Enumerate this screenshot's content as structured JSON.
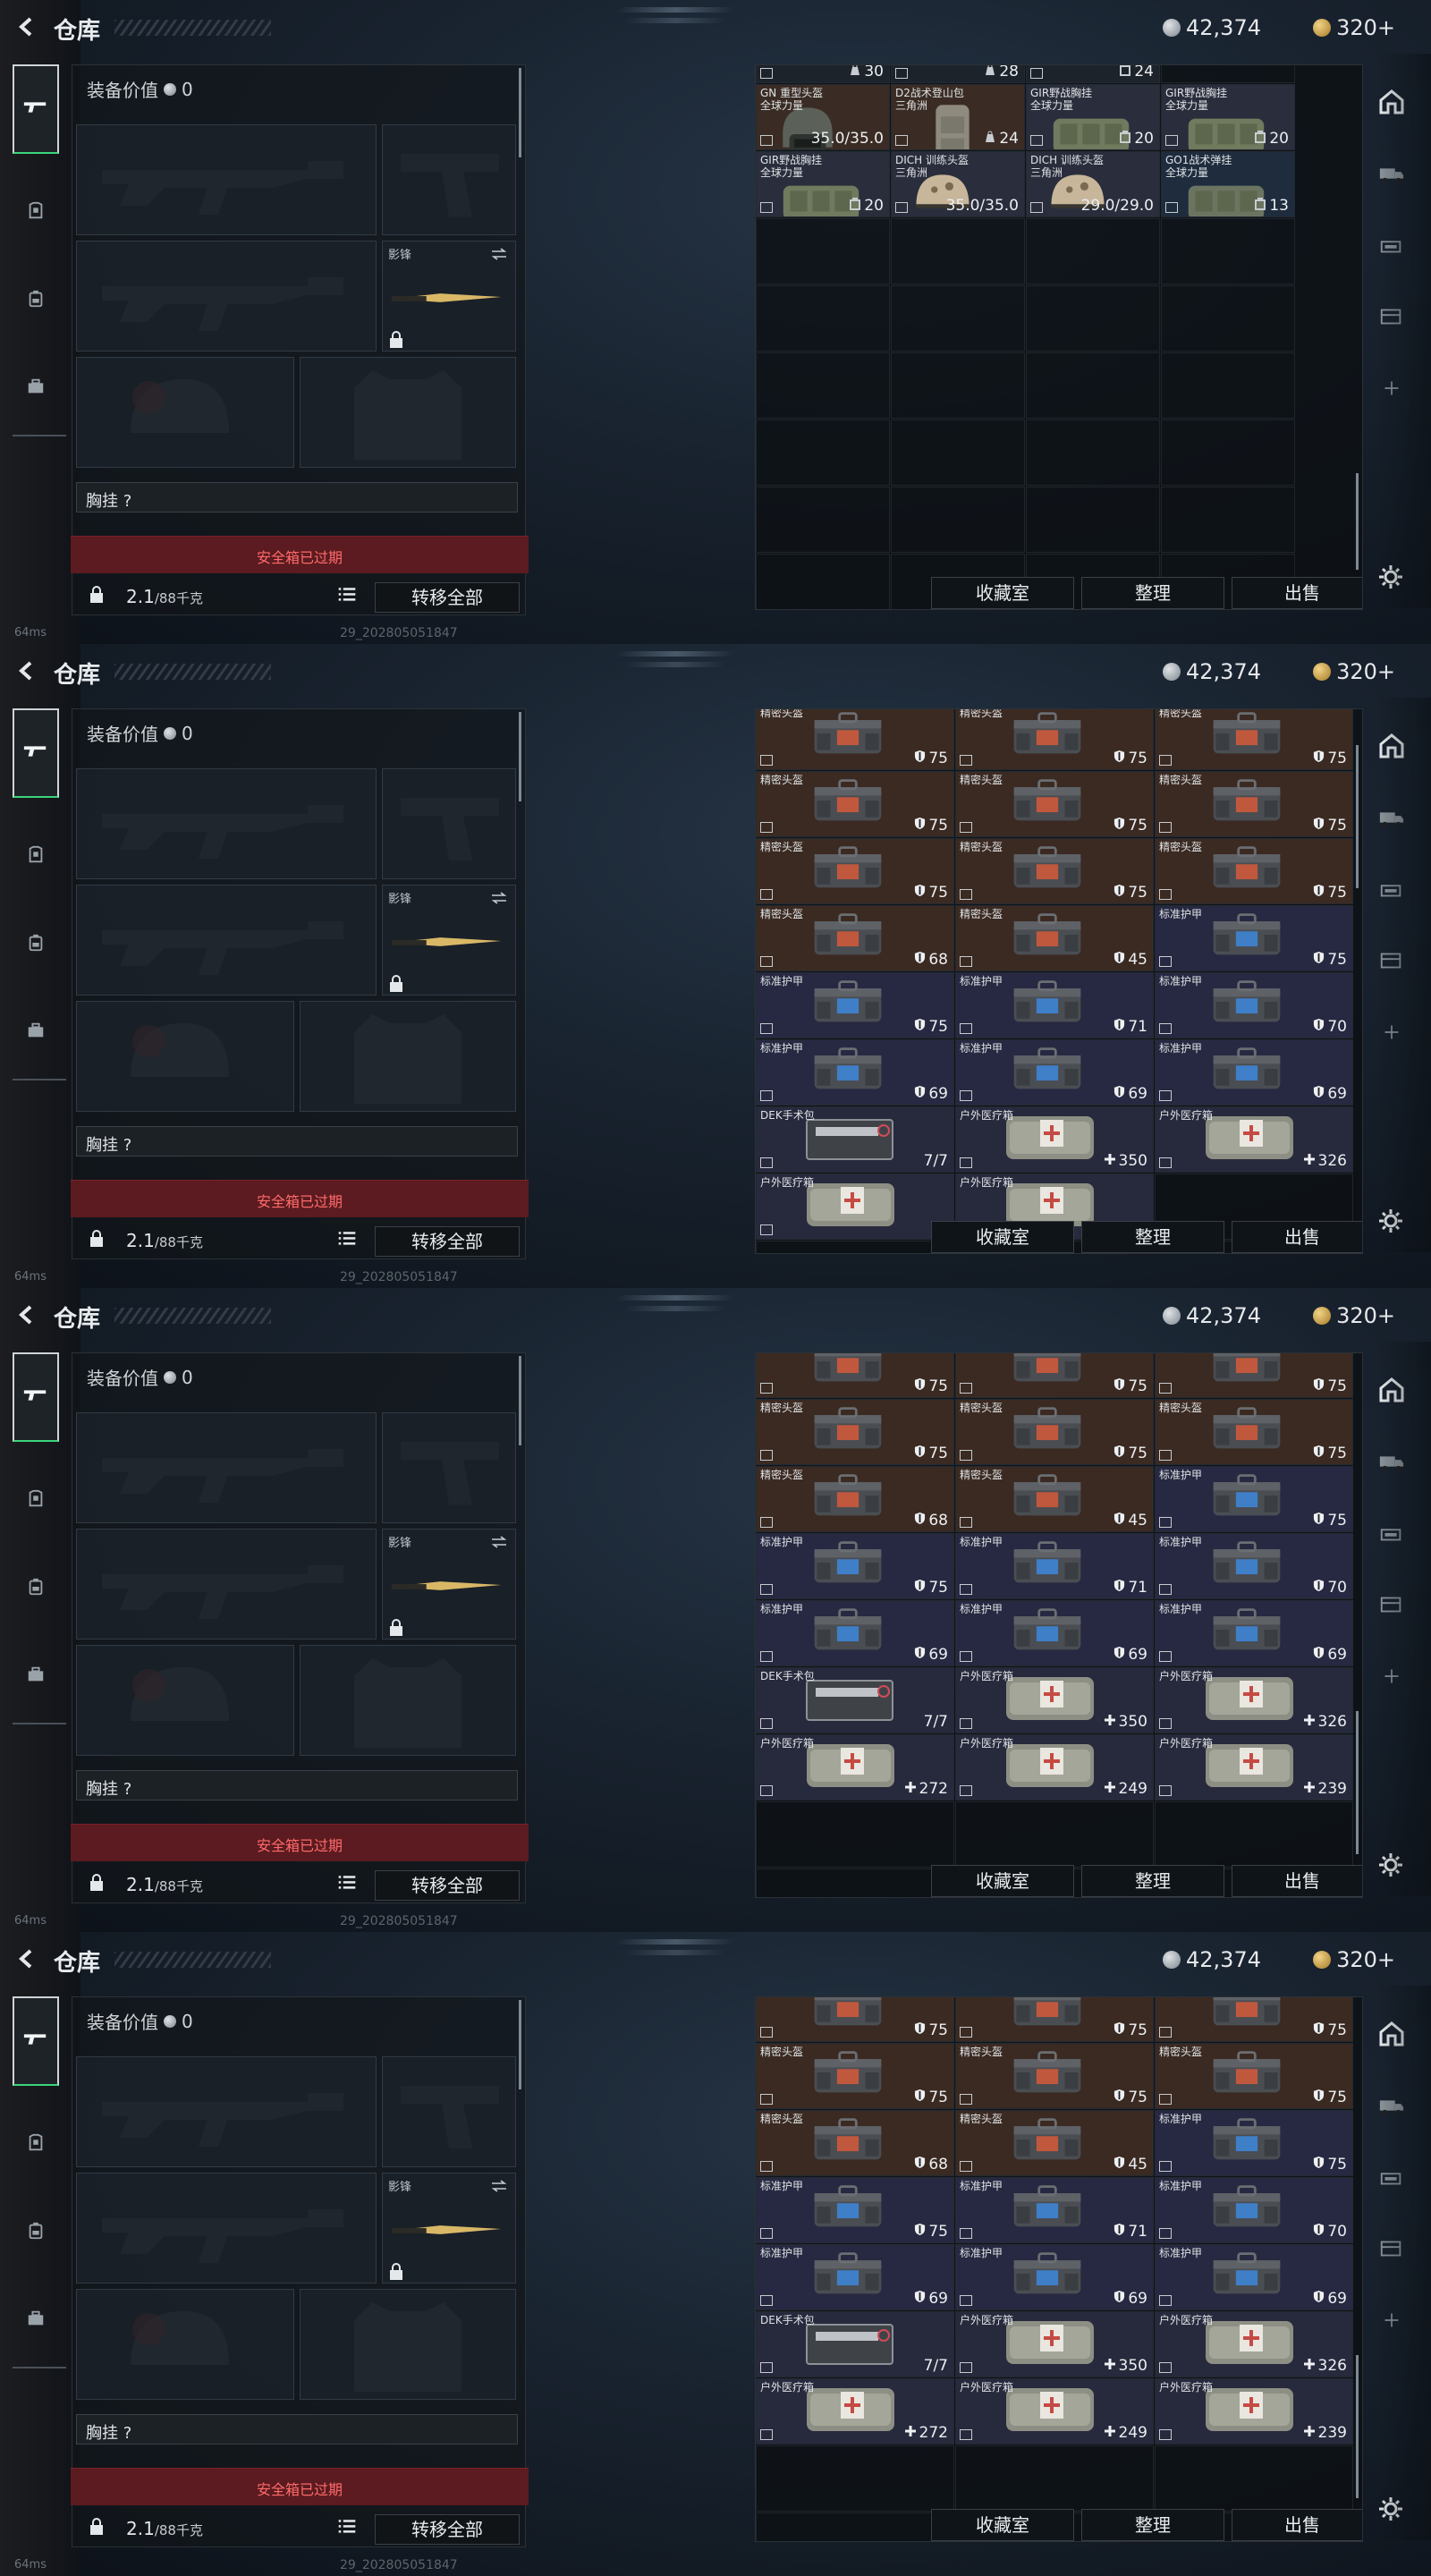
{
  "header": {
    "title": "仓库",
    "silver": "42,374",
    "gold": "320+"
  },
  "nav": {
    "items": [
      "weapon-icon",
      "armor-icon",
      "backpack-icon",
      "case-icon"
    ]
  },
  "equipment": {
    "value_label": "装备价值",
    "value": "0",
    "knife_label": "影锋",
    "chest_label": "胸挂",
    "chest_value": "?",
    "safe_box": "安全箱已过期",
    "weight": "2.1",
    "weight_cap": "/88千克",
    "transfer": "转移全部"
  },
  "store": {
    "buttons": {
      "collection": "收藏室",
      "sort": "整理",
      "sell": "出售"
    }
  },
  "status": {
    "ping": "64ms",
    "uid": "29_202805051847"
  },
  "frames": [
    {
      "rows": [
        [
          {
            "n": "",
            "v": "30",
            "k": "weight"
          },
          {
            "n": "",
            "v": "28",
            "k": "weight"
          },
          {
            "n": "",
            "v": "24",
            "k": "cap"
          }
        ],
        [
          {
            "n": "GN 重型头盔\n全球力量",
            "v": "35.0/35.0",
            "k": "helmet-gray"
          },
          {
            "n": "D2战术登山包\n三角洲",
            "v": "24",
            "k": "bag"
          },
          {
            "n": "GIR野战胸挂\n全球力量",
            "v": "20",
            "k": "rig"
          },
          {
            "n": "GIR野战胸挂\n全球力量",
            "v": "20",
            "k": "rig"
          }
        ],
        [
          {
            "n": "GIR野战胸挂\n全球力量",
            "v": "20",
            "k": "rig"
          },
          {
            "n": "DICH 训练头盔\n三角洲",
            "v": "35.0/35.0",
            "k": "helmet-tan"
          },
          {
            "n": "DICH 训练头盔\n三角洲",
            "v": "29.0/29.0",
            "k": "helmet-tan"
          },
          {
            "n": "GO1战术弹挂\n全球力量",
            "v": "13",
            "k": "rig-blue"
          }
        ]
      ]
    },
    {
      "rows": [
        [
          {
            "n": "精密头盔",
            "v": "75",
            "k": "case-red"
          },
          {
            "n": "精密头盔",
            "v": "75",
            "k": "case-red"
          },
          {
            "n": "精密头盔",
            "v": "75",
            "k": "case-red"
          }
        ],
        [
          {
            "n": "精密头盔",
            "v": "75",
            "k": "case-red"
          },
          {
            "n": "精密头盔",
            "v": "75",
            "k": "case-red"
          },
          {
            "n": "精密头盔",
            "v": "75",
            "k": "case-red"
          }
        ],
        [
          {
            "n": "精密头盔",
            "v": "75",
            "k": "case-red"
          },
          {
            "n": "精密头盔",
            "v": "75",
            "k": "case-red"
          },
          {
            "n": "精密头盔",
            "v": "75",
            "k": "case-red"
          }
        ],
        [
          {
            "n": "精密头盔",
            "v": "68",
            "k": "case-red"
          },
          {
            "n": "精密头盔",
            "v": "45",
            "k": "case-red"
          },
          {
            "n": "标准护甲",
            "v": "75",
            "k": "case-blue"
          }
        ],
        [
          {
            "n": "标准护甲",
            "v": "75",
            "k": "case-blue"
          },
          {
            "n": "标准护甲",
            "v": "71",
            "k": "case-blue"
          },
          {
            "n": "标准护甲",
            "v": "70",
            "k": "case-blue"
          }
        ],
        [
          {
            "n": "标准护甲",
            "v": "69",
            "k": "case-blue"
          },
          {
            "n": "标准护甲",
            "v": "69",
            "k": "case-blue"
          },
          {
            "n": "标准护甲",
            "v": "69",
            "k": "case-blue"
          }
        ],
        [
          {
            "n": "DEK手术包",
            "v": "7/7",
            "k": "surgery"
          },
          {
            "n": "户外医疗箱",
            "v": "350",
            "k": "medkit"
          },
          {
            "n": "户外医疗箱",
            "v": "326",
            "k": "medkit"
          }
        ],
        [
          {
            "n": "户外医疗箱",
            "v": "",
            "k": "medkit"
          },
          {
            "n": "户外医疗箱",
            "v": "",
            "k": "medkit"
          },
          {
            "n": "",
            "v": "",
            "k": "empty"
          }
        ]
      ]
    },
    {
      "rows": [
        [
          {
            "n": "",
            "v": "75",
            "k": "case-red"
          },
          {
            "n": "",
            "v": "75",
            "k": "case-red"
          },
          {
            "n": "",
            "v": "75",
            "k": "case-red"
          }
        ],
        [
          {
            "n": "精密头盔",
            "v": "75",
            "k": "case-red"
          },
          {
            "n": "精密头盔",
            "v": "75",
            "k": "case-red"
          },
          {
            "n": "精密头盔",
            "v": "75",
            "k": "case-red"
          }
        ],
        [
          {
            "n": "精密头盔",
            "v": "68",
            "k": "case-red"
          },
          {
            "n": "精密头盔",
            "v": "45",
            "k": "case-red"
          },
          {
            "n": "标准护甲",
            "v": "75",
            "k": "case-blue"
          }
        ],
        [
          {
            "n": "标准护甲",
            "v": "75",
            "k": "case-blue"
          },
          {
            "n": "标准护甲",
            "v": "71",
            "k": "case-blue"
          },
          {
            "n": "标准护甲",
            "v": "70",
            "k": "case-blue"
          }
        ],
        [
          {
            "n": "标准护甲",
            "v": "69",
            "k": "case-blue"
          },
          {
            "n": "标准护甲",
            "v": "69",
            "k": "case-blue"
          },
          {
            "n": "标准护甲",
            "v": "69",
            "k": "case-blue"
          }
        ],
        [
          {
            "n": "DEK手术包",
            "v": "7/7",
            "k": "surgery"
          },
          {
            "n": "户外医疗箱",
            "v": "350",
            "k": "medkit"
          },
          {
            "n": "户外医疗箱",
            "v": "326",
            "k": "medkit"
          }
        ],
        [
          {
            "n": "户外医疗箱",
            "v": "272",
            "k": "medkit"
          },
          {
            "n": "户外医疗箱",
            "v": "249",
            "k": "medkit"
          },
          {
            "n": "户外医疗箱",
            "v": "239",
            "k": "medkit"
          }
        ]
      ]
    },
    {
      "rows": [
        [
          {
            "n": "",
            "v": "75",
            "k": "case-red"
          },
          {
            "n": "",
            "v": "75",
            "k": "case-red"
          },
          {
            "n": "",
            "v": "75",
            "k": "case-red"
          }
        ],
        [
          {
            "n": "精密头盔",
            "v": "75",
            "k": "case-red"
          },
          {
            "n": "精密头盔",
            "v": "75",
            "k": "case-red"
          },
          {
            "n": "精密头盔",
            "v": "75",
            "k": "case-red"
          }
        ],
        [
          {
            "n": "精密头盔",
            "v": "68",
            "k": "case-red"
          },
          {
            "n": "精密头盔",
            "v": "45",
            "k": "case-red"
          },
          {
            "n": "标准护甲",
            "v": "75",
            "k": "case-blue"
          }
        ],
        [
          {
            "n": "标准护甲",
            "v": "75",
            "k": "case-blue"
          },
          {
            "n": "标准护甲",
            "v": "71",
            "k": "case-blue"
          },
          {
            "n": "标准护甲",
            "v": "70",
            "k": "case-blue"
          }
        ],
        [
          {
            "n": "标准护甲",
            "v": "69",
            "k": "case-blue"
          },
          {
            "n": "标准护甲",
            "v": "69",
            "k": "case-blue"
          },
          {
            "n": "标准护甲",
            "v": "69",
            "k": "case-blue"
          }
        ],
        [
          {
            "n": "DEK手术包",
            "v": "7/7",
            "k": "surgery"
          },
          {
            "n": "户外医疗箱",
            "v": "350",
            "k": "medkit"
          },
          {
            "n": "户外医疗箱",
            "v": "326",
            "k": "medkit"
          }
        ],
        [
          {
            "n": "户外医疗箱",
            "v": "272",
            "k": "medkit"
          },
          {
            "n": "户外医疗箱",
            "v": "249",
            "k": "medkit"
          },
          {
            "n": "户外医疗箱",
            "v": "239",
            "k": "medkit"
          }
        ]
      ]
    }
  ]
}
